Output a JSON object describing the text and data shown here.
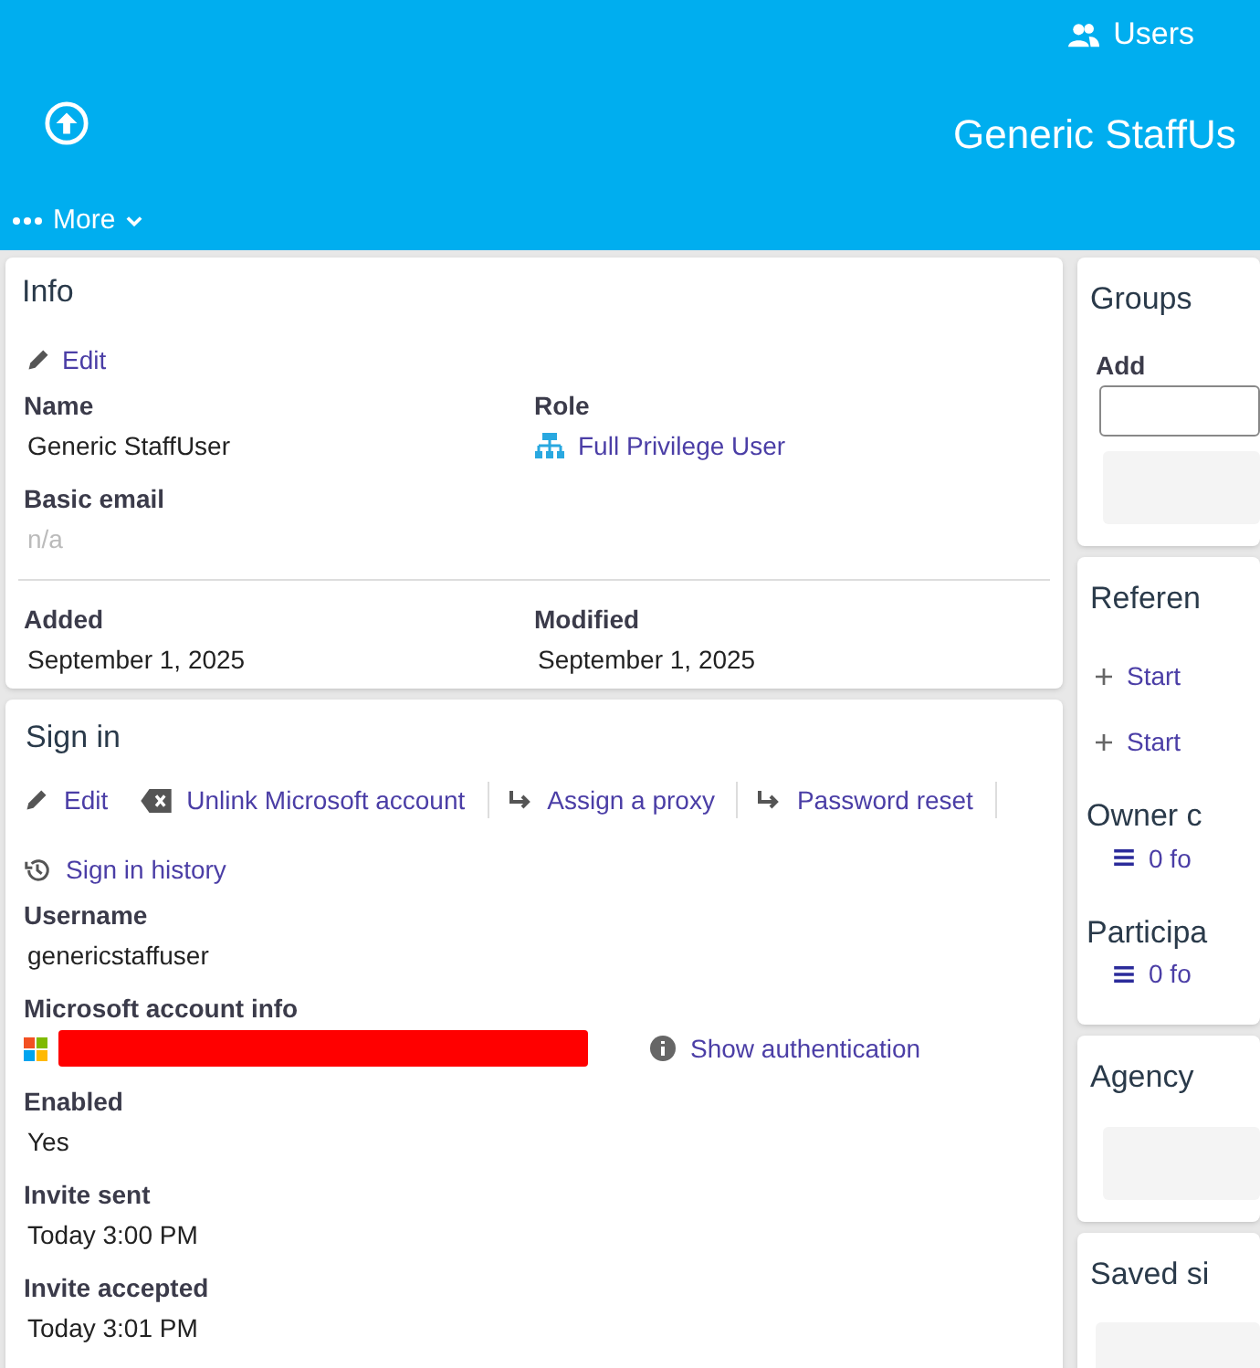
{
  "header": {
    "nav_link": "Users",
    "title": "Generic StaffUs",
    "more_menu": "More"
  },
  "info": {
    "title": "Info",
    "edit": "Edit",
    "fields": [
      {
        "label": "Name",
        "value": "Generic StaffUser",
        "kind": "text"
      },
      {
        "label": "Role",
        "value": "Full Privilege User",
        "kind": "link"
      },
      {
        "label": "Basic email",
        "value": "n/a",
        "kind": "empty"
      }
    ],
    "dates": [
      {
        "label": "Added",
        "value": "September 1, 2025"
      },
      {
        "label": "Modified",
        "value": "September 1, 2025"
      }
    ]
  },
  "sign_in": {
    "title": "Sign in",
    "actions": [
      {
        "label": "Edit",
        "kind": "edit"
      },
      {
        "label": "Unlink Microsoft account",
        "kind": "unlink"
      },
      {
        "label": "Assign a proxy",
        "kind": "forward"
      },
      {
        "label": "Password reset",
        "kind": "forward"
      },
      {
        "label": "Sign in history",
        "kind": "history"
      }
    ],
    "username_label": "Username",
    "username": "genericstaffuser",
    "account_label": "Microsoft account info",
    "show_auth": "Show authentication",
    "fields": [
      {
        "label": "Enabled",
        "value": "Yes"
      },
      {
        "label": "Invite sent",
        "value": "Today 3:00 PM"
      },
      {
        "label": "Invite accepted",
        "value": "Today 3:01 PM"
      }
    ]
  },
  "side": {
    "groups_title": "Groups",
    "add_label": "Add",
    "references_title": "Referen",
    "start_links": [
      "Start",
      "Start"
    ],
    "subsections": [
      {
        "title": "Owner c",
        "count": "0 fo"
      },
      {
        "title": "Participa",
        "count": "0 fo"
      }
    ],
    "agency_title": "Agency",
    "saved_title": "Saved si"
  }
}
